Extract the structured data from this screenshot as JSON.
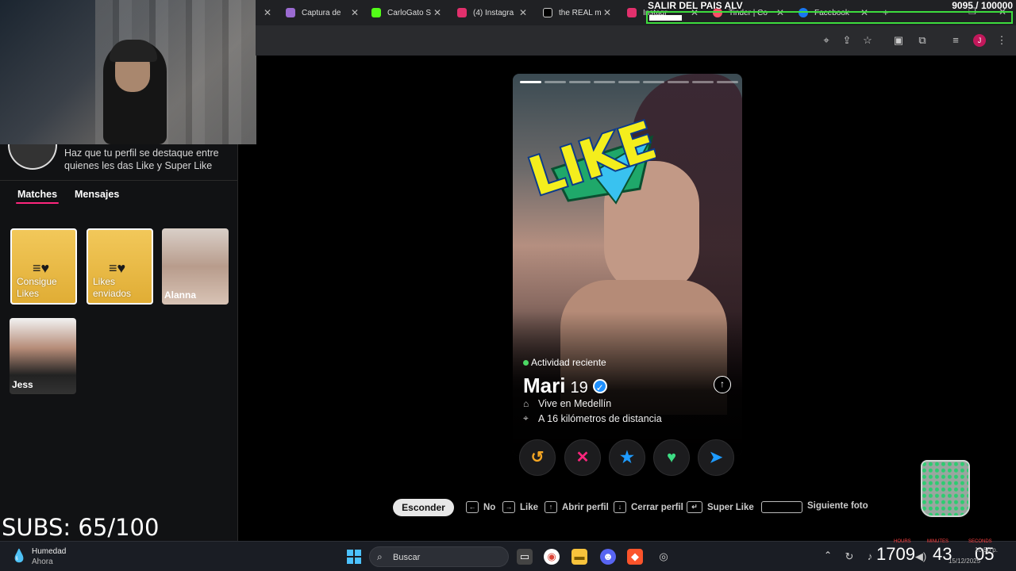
{
  "browser": {
    "tabs": [
      {
        "label": "Captura de",
        "icon": "feather-icon",
        "color": "#9b6bd1"
      },
      {
        "label": "CarloGato S",
        "icon": "kick-icon",
        "color": "#53fc18"
      },
      {
        "label": "(4) Instagra",
        "icon": "instagram-icon",
        "color": "#e1306c"
      },
      {
        "label": "the REAL m",
        "icon": "tiktok-icon",
        "color": "#000000"
      },
      {
        "label": "Instagr",
        "icon": "instagram-icon",
        "color": "#e1306c"
      },
      {
        "label": "Tinder | Co",
        "icon": "tinder-icon",
        "color": "#fd5068"
      },
      {
        "label": "Facebook",
        "icon": "facebook-icon",
        "color": "#1877f2"
      }
    ],
    "profile_initial": "J"
  },
  "overlay": {
    "title": "SALIR DEL PAIS ALV",
    "goal": "9095  / 100000",
    "goal_progress": 0.09,
    "subs": "SUBS: 65/100"
  },
  "sidebar": {
    "promo_text": "Haz que tu perfil se destaque entre quienes les das Like y Super Like",
    "tabs": [
      {
        "label": "Matches"
      },
      {
        "label": "Mensajes"
      }
    ],
    "gold_cards": [
      {
        "label": "Consigue Likes"
      },
      {
        "label": "Likes enviados"
      }
    ],
    "matches": [
      {
        "name": "Alanna"
      },
      {
        "name": "Jess"
      }
    ]
  },
  "profile": {
    "stamp": "LIKE",
    "activity": "Actividad reciente",
    "name": "Mari",
    "age": "19",
    "location": "Vive en Medellín",
    "distance": "A 16 kilómetros de distancia",
    "photo_count": 9,
    "active_photo": 0
  },
  "actions": [
    {
      "name": "rewind",
      "symbol": "↺",
      "color": "#f5a623"
    },
    {
      "name": "nope",
      "symbol": "✕",
      "color": "#fd267d"
    },
    {
      "name": "super-like",
      "symbol": "★",
      "color": "#1e9bff"
    },
    {
      "name": "like",
      "symbol": "♥",
      "color": "#3ddc84"
    },
    {
      "name": "boost",
      "symbol": "➤",
      "color": "#1e9bff"
    }
  ],
  "shortcuts": {
    "hide": "Esconder",
    "no": "No",
    "like": "Like",
    "open": "Abrir perfil",
    "close": "Cerrar perfil",
    "super": "Super Like",
    "next": "Siguiente foto"
  },
  "taskbar": {
    "weather_title": "Humedad",
    "weather_sub": "Ahora",
    "search": "Buscar",
    "clock": {
      "hours": "1709",
      "minutes": "43",
      "seconds": "05",
      "lbl_h": "HOURS",
      "lbl_m": "MINUTES",
      "lbl_s": "SECONDS"
    },
    "time": "10:50 p.",
    "date": "15/12/2025"
  }
}
